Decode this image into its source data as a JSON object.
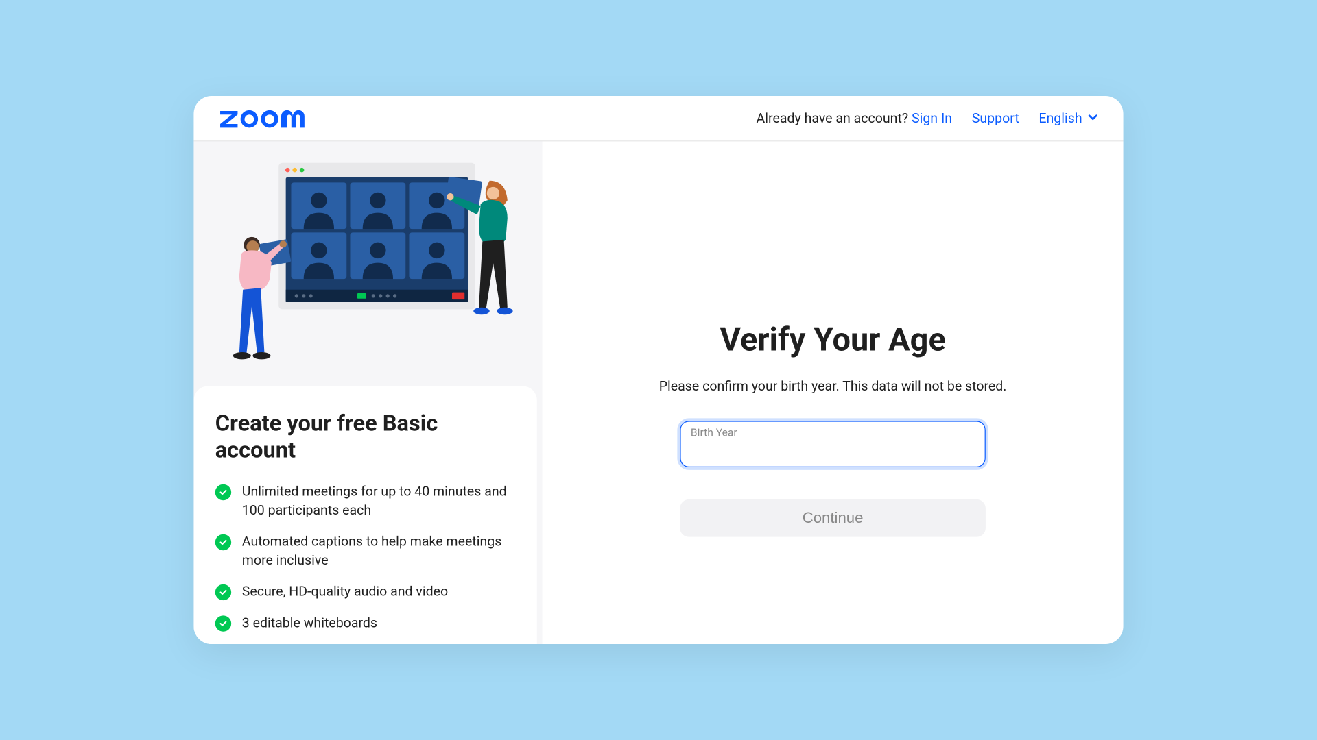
{
  "header": {
    "already_text": "Already have an account?",
    "signin": "Sign In",
    "support": "Support",
    "language": "English"
  },
  "left": {
    "title": "Create your free Basic account",
    "features": [
      "Unlimited meetings for up to 40 minutes and 100 participants each",
      "Automated captions to help make meetings more inclusive",
      "Secure, HD-quality audio and video",
      "3 editable whiteboards"
    ]
  },
  "right": {
    "title": "Verify Your Age",
    "subtitle": "Please confirm your birth year. This data will not be stored.",
    "input_label": "Birth Year",
    "continue": "Continue"
  }
}
